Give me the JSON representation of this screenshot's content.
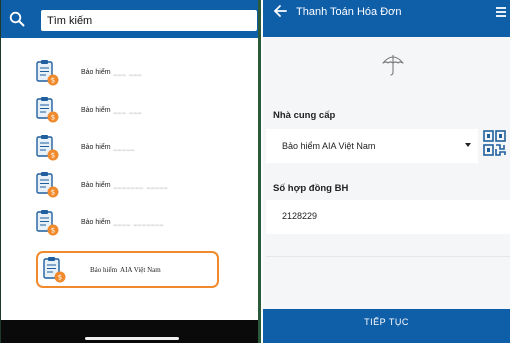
{
  "search": {
    "value": "Tìm kiếm"
  },
  "insurance_list": {
    "items": [
      {
        "label": "Bảo hiểm",
        "suffix": "___ ___"
      },
      {
        "label": "Bảo hiểm",
        "suffix": "___ ___"
      },
      {
        "label": "Bảo hiểm",
        "suffix": "_____"
      },
      {
        "label": "Bảo hiểm",
        "suffix": "_______ _____"
      },
      {
        "label": "Bảo hiểm",
        "suffix": "____ _______"
      }
    ],
    "selected": {
      "label": "Bảo hiểm",
      "suffix": "AIA Việt Nam"
    }
  },
  "right": {
    "title": "Thanh Toán Hóa Đơn",
    "provider_label": "Nhà cung cấp",
    "provider_value": "Bảo hiểm AIA Việt Nam",
    "contract_label": "Số hợp đồng BH",
    "contract_value": "2128229",
    "continue_label": "TIẾP TỤC"
  },
  "colors": {
    "header_blue": "#0f5ea8",
    "selection_orange": "#f08a2c",
    "icon_orange": "#f08a2c",
    "icon_blue": "#1f5f9e"
  },
  "icons": {
    "search": "search-icon",
    "document": "clipboard-document-icon",
    "back": "arrow-left-icon",
    "menu": "hamburger-menu-icon",
    "umbrella": "umbrella-icon",
    "qr": "qr-code-icon",
    "dropdown": "caret-down-icon"
  }
}
